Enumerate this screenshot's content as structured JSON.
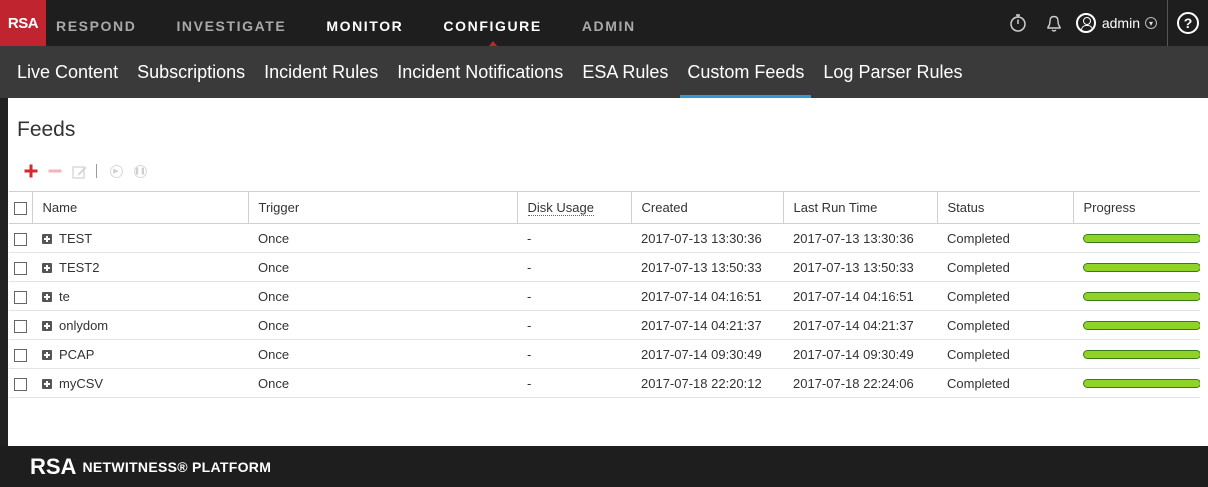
{
  "topbar": {
    "logo": "RSA",
    "nav": [
      {
        "label": "RESPOND",
        "name": "nav-respond"
      },
      {
        "label": "INVESTIGATE",
        "name": "nav-investigate"
      },
      {
        "label": "MONITOR",
        "name": "nav-monitor"
      },
      {
        "label": "CONFIGURE",
        "name": "nav-configure"
      },
      {
        "label": "ADMIN",
        "name": "nav-admin"
      }
    ],
    "active_nav": "CONFIGURE",
    "user": "admin",
    "help": "?",
    "icons": [
      "timer-icon",
      "bell-icon",
      "user-icon",
      "help-icon"
    ]
  },
  "subnav": {
    "items": [
      "Live Content",
      "Subscriptions",
      "Incident Rules",
      "Incident Notifications",
      "ESA Rules",
      "Custom Feeds",
      "Log Parser Rules"
    ],
    "active": "Custom Feeds"
  },
  "main": {
    "title": "Feeds",
    "toolbar_icons": [
      "add-icon",
      "remove-icon",
      "edit-icon",
      "play-icon",
      "pause-icon"
    ]
  },
  "table": {
    "columns": [
      "Name",
      "Trigger",
      "Disk Usage",
      "Created",
      "Last Run Time",
      "Status",
      "Progress"
    ],
    "rows": [
      {
        "name": "TEST",
        "trigger": "Once",
        "disk_usage": "-",
        "created": "2017-07-13 13:30:36",
        "last_run": "2017-07-13 13:30:36",
        "status": "Completed",
        "progress": 1.0
      },
      {
        "name": "TEST2",
        "trigger": "Once",
        "disk_usage": "-",
        "created": "2017-07-13 13:50:33",
        "last_run": "2017-07-13 13:50:33",
        "status": "Completed",
        "progress": 1.0
      },
      {
        "name": "te",
        "trigger": "Once",
        "disk_usage": "-",
        "created": "2017-07-14 04:16:51",
        "last_run": "2017-07-14 04:16:51",
        "status": "Completed",
        "progress": 1.0
      },
      {
        "name": "onlydom",
        "trigger": "Once",
        "disk_usage": "-",
        "created": "2017-07-14 04:21:37",
        "last_run": "2017-07-14 04:21:37",
        "status": "Completed",
        "progress": 1.0
      },
      {
        "name": "PCAP",
        "trigger": "Once",
        "disk_usage": "-",
        "created": "2017-07-14 09:30:49",
        "last_run": "2017-07-14 09:30:49",
        "status": "Completed",
        "progress": 1.0
      },
      {
        "name": "myCSV",
        "trigger": "Once",
        "disk_usage": "-",
        "created": "2017-07-18 22:20:12",
        "last_run": "2017-07-18 22:24:06",
        "status": "Completed",
        "progress": 1.0
      }
    ]
  },
  "footer": {
    "brand": "RSA",
    "product": "NETWITNESS® PLATFORM"
  },
  "colors": {
    "accent_red": "#c0242f",
    "active_tab_blue": "#2c9bd5",
    "progress_green": "#8ed325",
    "topbar_bg": "#1e1e1e",
    "subbar_bg": "#3a3a3a"
  }
}
